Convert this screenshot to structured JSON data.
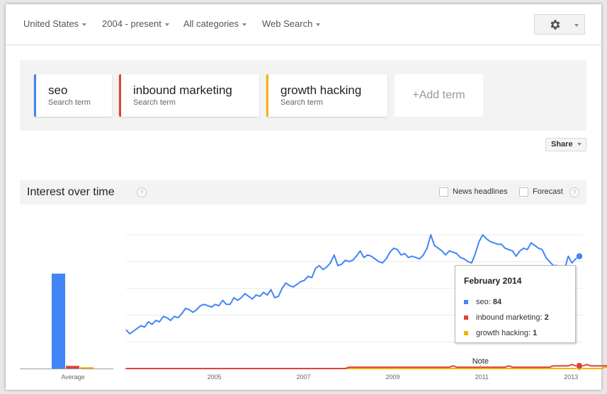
{
  "filters": [
    {
      "label": "United States"
    },
    {
      "label": "2004 - present"
    },
    {
      "label": "All categories"
    },
    {
      "label": "Web Search"
    }
  ],
  "settings": {
    "icon": "gear-icon"
  },
  "terms": [
    {
      "name": "seo",
      "sub": "Search term",
      "color": "#4285f4"
    },
    {
      "name": "inbound marketing",
      "sub": "Search term",
      "color": "#db4437"
    },
    {
      "name": "growth hacking",
      "sub": "Search term",
      "color": "#f4b400"
    }
  ],
  "add_term_label": "+Add term",
  "share_label": "Share",
  "interest": {
    "title": "Interest over time",
    "help": "?",
    "news_headlines_label": "News headlines",
    "forecast_label": "Forecast"
  },
  "tooltip": {
    "title": "February 2014",
    "rows": [
      {
        "label": "seo: ",
        "value": "84",
        "color": "#4285f4"
      },
      {
        "label": "inbound marketing: ",
        "value": "2",
        "color": "#db4437"
      },
      {
        "label": "growth hacking: ",
        "value": "1",
        "color": "#f4b400"
      }
    ]
  },
  "chart_data": {
    "type": "line",
    "title": "Interest over time",
    "x_start": "2004-01",
    "x_end": "2014-02",
    "frequency": "monthly",
    "xticks": [
      "2005",
      "2007",
      "2009",
      "2011",
      "2013"
    ],
    "ylim": [
      0,
      100
    ],
    "grid": true,
    "note_label": "Note",
    "note_at": "2011",
    "averages": {
      "label": "Average",
      "values": [
        {
          "name": "seo",
          "value": 71
        },
        {
          "name": "inbound marketing",
          "value": 2
        },
        {
          "name": "growth hacking",
          "value": 1
        }
      ]
    },
    "series": [
      {
        "name": "seo",
        "color": "#4285f4",
        "values": [
          29,
          26,
          28,
          30,
          32,
          31,
          35,
          33,
          36,
          35,
          39,
          38,
          36,
          39,
          38,
          41,
          45,
          44,
          42,
          44,
          47,
          48,
          47,
          46,
          48,
          47,
          51,
          48,
          48,
          53,
          51,
          53,
          56,
          54,
          52,
          55,
          54,
          57,
          55,
          59,
          53,
          54,
          60,
          64,
          62,
          61,
          63,
          65,
          66,
          69,
          68,
          75,
          77,
          74,
          76,
          79,
          85,
          77,
          78,
          81,
          80,
          81,
          84,
          88,
          83,
          85,
          84,
          82,
          80,
          79,
          82,
          87,
          90,
          89,
          85,
          86,
          83,
          84,
          83,
          82,
          85,
          90,
          100,
          92,
          90,
          88,
          85,
          88,
          87,
          86,
          83,
          82,
          80,
          79,
          86,
          95,
          100,
          97,
          95,
          94,
          93,
          93,
          90,
          89,
          88,
          84,
          88,
          90,
          89,
          94,
          92,
          90,
          89,
          83,
          80,
          77,
          77,
          72,
          74,
          84,
          79,
          82,
          84
        ]
      },
      {
        "name": "inbound marketing",
        "color": "#db4437",
        "values": [
          0,
          0,
          0,
          0,
          0,
          0,
          0,
          0,
          0,
          0,
          0,
          0,
          0,
          0,
          0,
          0,
          0,
          0,
          0,
          0,
          0,
          0,
          0,
          0,
          0,
          0,
          0,
          0,
          0,
          0,
          0,
          0,
          0,
          0,
          0,
          0,
          0,
          0,
          0,
          0,
          0,
          0,
          0,
          0,
          0,
          0,
          0,
          0,
          0,
          0,
          0,
          0,
          0,
          0,
          0,
          0,
          0,
          0,
          0,
          0,
          1,
          1,
          1,
          1,
          1,
          1,
          1,
          1,
          1,
          1,
          1,
          1,
          1,
          1,
          1,
          1,
          1,
          1,
          1,
          1,
          1,
          1,
          1,
          1,
          1,
          1,
          1,
          1,
          2,
          1,
          1,
          1,
          1,
          1,
          1,
          1,
          1,
          1,
          1,
          1,
          1,
          1,
          1,
          2,
          1,
          1,
          1,
          1,
          1,
          1,
          1,
          1,
          1,
          1,
          1,
          2,
          2,
          2,
          2,
          2,
          3,
          2,
          2,
          2,
          3,
          2,
          2,
          2,
          2,
          2,
          2,
          2,
          2,
          2
        ]
      },
      {
        "name": "growth hacking",
        "color": "#f4b400",
        "values": [
          0,
          0,
          0,
          0,
          0,
          0,
          0,
          0,
          0,
          0,
          0,
          0,
          0,
          0,
          0,
          0,
          0,
          0,
          0,
          0,
          0,
          0,
          0,
          0,
          0,
          0,
          0,
          0,
          0,
          0,
          0,
          0,
          0,
          0,
          0,
          0,
          0,
          0,
          0,
          0,
          0,
          0,
          0,
          0,
          0,
          0,
          0,
          0,
          0,
          0,
          0,
          0,
          0,
          0,
          0,
          0,
          0,
          0,
          0,
          0,
          0,
          0,
          0,
          0,
          0,
          0,
          0,
          0,
          0,
          0,
          0,
          0,
          0,
          0,
          0,
          0,
          0,
          0,
          0,
          0,
          0,
          0,
          0,
          0,
          0,
          0,
          0,
          0,
          0,
          0,
          0,
          0,
          0,
          0,
          0,
          0,
          0,
          0,
          0,
          0,
          0,
          0,
          0,
          0,
          0,
          0,
          0,
          0,
          0,
          0,
          0,
          0,
          0,
          0,
          0,
          0,
          0,
          0,
          0,
          0,
          0,
          0,
          0,
          0,
          0,
          0,
          0,
          0,
          0,
          1,
          1,
          0,
          1,
          1
        ]
      }
    ]
  }
}
